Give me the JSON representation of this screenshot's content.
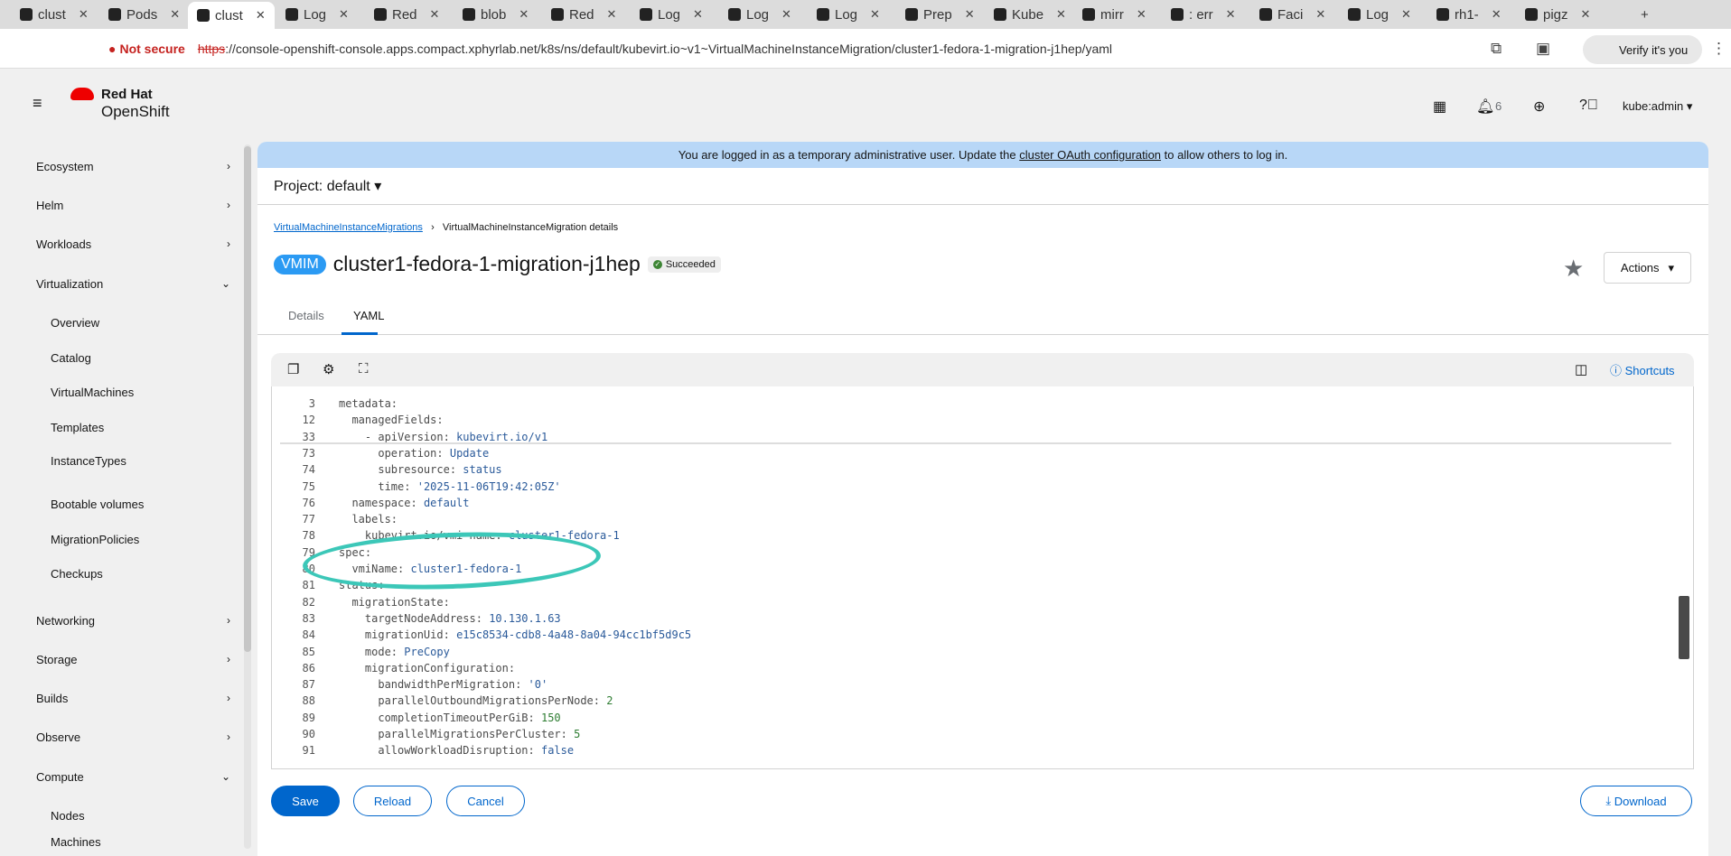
{
  "browser": {
    "tabs": [
      "clust",
      "Pods",
      "clust",
      "Log",
      "Red",
      "blob",
      "Red",
      "Log",
      "Log",
      "Log",
      "Prep",
      "Kube",
      "mirr",
      ": err",
      "Faci",
      "Log",
      "rh1-",
      "pigz"
    ],
    "new_tab": "+",
    "not_secure": "Not secure",
    "url_scheme": "https",
    "url_rest": "://console-openshift-console.apps.compact.xphyrlab.net/k8s/ns/default/kubevirt.io~v1~VirtualMachineInstanceMigration/cluster1-fedora-1-migration-j1hep/yaml",
    "verify": "Verify it's you"
  },
  "masthead": {
    "brand1": "Red Hat",
    "brand2": "OpenShift",
    "notifications": "6",
    "user": "kube:admin"
  },
  "sidebar": {
    "items": [
      {
        "label": "Ecosystem",
        "chev": "›"
      },
      {
        "label": "Helm",
        "chev": "›"
      },
      {
        "label": "Workloads",
        "chev": "›"
      },
      {
        "label": "Virtualization",
        "chev": "⌄"
      },
      {
        "label": "Networking",
        "chev": "›"
      },
      {
        "label": "Storage",
        "chev": "›"
      },
      {
        "label": "Builds",
        "chev": "›"
      },
      {
        "label": "Observe",
        "chev": "›"
      },
      {
        "label": "Compute",
        "chev": "⌄"
      }
    ],
    "virt_sub": [
      "Overview",
      "Catalog",
      "VirtualMachines",
      "Templates",
      "InstanceTypes",
      "Bootable volumes",
      "MigrationPolicies",
      "Checkups"
    ],
    "compute_sub": [
      "Nodes",
      "Machines"
    ]
  },
  "banner": {
    "text": "You are logged in as a temporary administrative user. Update the ",
    "link": "cluster OAuth configuration",
    "suffix": " to allow others to log in."
  },
  "project": "Project: default",
  "breadcrumb": {
    "link": "VirtualMachineInstanceMigrations",
    "current": "VirtualMachineInstanceMigration details"
  },
  "title": {
    "badge": "VMIM",
    "name": "cluster1-fedora-1-migration-j1hep",
    "status": "Succeeded",
    "actions": "Actions"
  },
  "tabs": [
    "Details",
    "YAML"
  ],
  "editor": {
    "shortcuts": "Shortcuts",
    "lines": [
      {
        "n": "3",
        "i": 0,
        "k": "metadata:",
        "v": ""
      },
      {
        "n": "12",
        "i": 1,
        "k": "managedFields:",
        "v": ""
      },
      {
        "n": "33",
        "i": 2,
        "k": "- apiVersion: ",
        "v": "kubevirt.io/v1"
      },
      {
        "n": "73",
        "i": 3,
        "k": "operation: ",
        "v": "Update"
      },
      {
        "n": "74",
        "i": 3,
        "k": "subresource: ",
        "v": "status"
      },
      {
        "n": "75",
        "i": 3,
        "k": "time: ",
        "v": "'2025-11-06T19:42:05Z'"
      },
      {
        "n": "76",
        "i": 1,
        "k": "namespace: ",
        "v": "default"
      },
      {
        "n": "77",
        "i": 1,
        "k": "labels:",
        "v": ""
      },
      {
        "n": "78",
        "i": 2,
        "k": "kubevirt.io/vmi-name: ",
        "v": "cluster1-fedora-1"
      },
      {
        "n": "79",
        "i": 0,
        "k": "spec:",
        "v": ""
      },
      {
        "n": "80",
        "i": 1,
        "k": "vmiName: ",
        "v": "cluster1-fedora-1"
      },
      {
        "n": "81",
        "i": 0,
        "k": "status:",
        "v": ""
      },
      {
        "n": "82",
        "i": 1,
        "k": "migrationState:",
        "v": ""
      },
      {
        "n": "83",
        "i": 2,
        "k": "targetNodeAddress: ",
        "v": "10.130.1.63"
      },
      {
        "n": "84",
        "i": 2,
        "k": "migrationUid: ",
        "v": "e15c8534-cdb8-4a48-8a04-94cc1bf5d9c5"
      },
      {
        "n": "85",
        "i": 2,
        "k": "mode: ",
        "v": "PreCopy"
      },
      {
        "n": "86",
        "i": 2,
        "k": "migrationConfiguration:",
        "v": ""
      },
      {
        "n": "87",
        "i": 3,
        "k": "bandwidthPerMigration: ",
        "v": "'0'"
      },
      {
        "n": "88",
        "i": 3,
        "k": "parallelOutboundMigrationsPerNode: ",
        "v": "2"
      },
      {
        "n": "89",
        "i": 3,
        "k": "completionTimeoutPerGiB: ",
        "v": "150"
      },
      {
        "n": "90",
        "i": 3,
        "k": "parallelMigrationsPerCluster: ",
        "v": "5"
      },
      {
        "n": "91",
        "i": 3,
        "k": "allowWorkloadDisruption: ",
        "v": "false"
      }
    ]
  },
  "footer": {
    "save": "Save",
    "reload": "Reload",
    "cancel": "Cancel",
    "download": "Download"
  },
  "colors": {
    "primary": "#0066cc",
    "banner": "#b8d7f7",
    "success": "#3e8635",
    "annotation": "#3cc7b8"
  }
}
